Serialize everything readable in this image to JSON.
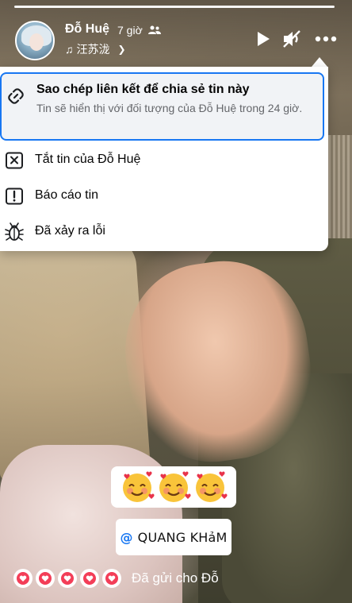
{
  "story": {
    "username": "Đỗ Huệ",
    "time": "7 giờ",
    "music": "汪苏泷",
    "controls": {
      "play_icon": "play-icon",
      "mute_icon": "volume-muted-icon",
      "more_icon": "more-options-icon"
    }
  },
  "menu": {
    "items": [
      {
        "icon": "link-icon",
        "title": "Sao chép liên kết để chia sẻ tin này",
        "description": "Tin sẽ hiển thị với đối tượng của Đỗ Huệ trong 24 giờ."
      },
      {
        "icon": "close-box-icon",
        "title": "Tắt tin của Đỗ Huệ"
      },
      {
        "icon": "report-icon",
        "title": "Báo cáo tin"
      },
      {
        "icon": "bug-icon",
        "title": "Đã xảy ra lỗi"
      }
    ]
  },
  "stickers": {
    "emoji_count": 3,
    "emoji_name": "smiling-face-with-hearts",
    "mention_at": "@",
    "mention_name": "QUANG KHảM"
  },
  "reactions": {
    "hearts_count": 5,
    "sent_text": "Đã gửi cho Đỗ"
  },
  "colors": {
    "accent": "#1877f2",
    "heart": "#f33e58"
  }
}
